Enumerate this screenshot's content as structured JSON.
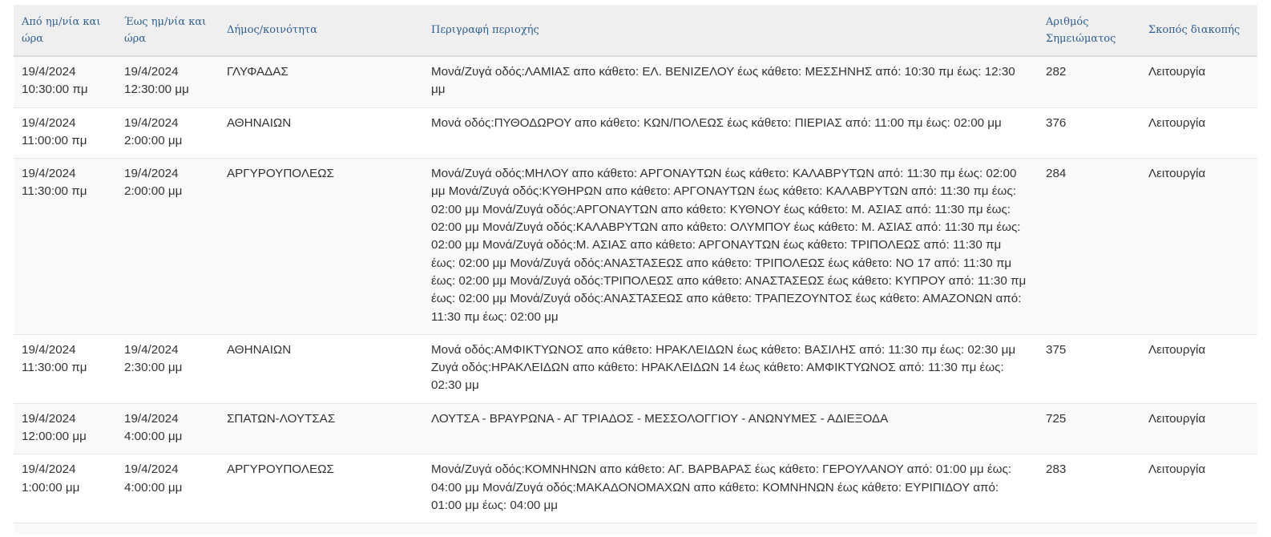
{
  "table": {
    "headers": [
      {
        "key": "from",
        "line1": "Από ημ/νία και",
        "line2": "ώρα"
      },
      {
        "key": "to",
        "line1": "Έως ημ/νία και",
        "line2": "ώρα"
      },
      {
        "key": "municipality",
        "line1": "Δήμος/κοινότητα",
        "line2": ""
      },
      {
        "key": "area",
        "line1": "Περιγραφή περιοχής",
        "line2": ""
      },
      {
        "key": "note_no",
        "line1": "Αριθμός",
        "line2": "Σημειώματος"
      },
      {
        "key": "purpose",
        "line1": "Σκοπός διακοπής",
        "line2": ""
      }
    ],
    "rows": [
      {
        "from_date": "19/4/2024",
        "from_time": "10:30:00 πμ",
        "to_date": "19/4/2024",
        "to_time": "12:30:00 μμ",
        "municipality": "ΓΛΥΦΑΔΑΣ",
        "area": "Μονά/Ζυγά οδός:ΛΑΜΙΑΣ απο κάθετο: ΕΛ. ΒΕΝΙΖΕΛΟΥ έως κάθετο: ΜΕΣΣΗΝΗΣ από: 10:30 πμ έως: 12:30 μμ",
        "note_no": "282",
        "purpose": "Λειτουργία"
      },
      {
        "from_date": "19/4/2024",
        "from_time": "11:00:00 πμ",
        "to_date": "19/4/2024",
        "to_time": "2:00:00 μμ",
        "municipality": "ΑΘΗΝΑΙΩΝ",
        "area": "Μονά οδός:ΠΥΘΟΔΩΡΟΥ απο κάθετο: ΚΩΝ/ΠΟΛΕΩΣ έως κάθετο: ΠΙΕΡΙΑΣ από: 11:00 πμ έως: 02:00 μμ",
        "note_no": "376",
        "purpose": "Λειτουργία"
      },
      {
        "from_date": "19/4/2024",
        "from_time": "11:30:00 πμ",
        "to_date": "19/4/2024",
        "to_time": "2:00:00 μμ",
        "municipality": "ΑΡΓΥΡΟΥΠΟΛΕΩΣ",
        "area": "Μονά/Ζυγά οδός:ΜΗΛΟΥ απο κάθετο: ΑΡΓΟΝΑΥΤΩΝ έως κάθετο: ΚΑΛΑΒΡΥΤΩΝ από: 11:30 πμ έως: 02:00 μμ Μονά/Ζυγά οδός:ΚΥΘΗΡΩΝ απο κάθετο: ΑΡΓΟΝΑΥΤΩΝ έως κάθετο: ΚΑΛΑΒΡΥΤΩΝ από: 11:30 πμ έως: 02:00 μμ Μονά/Ζυγά οδός:ΑΡΓΟΝΑΥΤΩΝ απο κάθετο: ΚΥΘΝΟΥ έως κάθετο: Μ. ΑΣΙΑΣ από: 11:30 πμ έως: 02:00 μμ Μονά/Ζυγά οδός:ΚΑΛΑΒΡΥΤΩΝ απο κάθετο: ΟΛΥΜΠΟΥ έως κάθετο: Μ. ΑΣΙΑΣ από: 11:30 πμ έως: 02:00 μμ Μονά/Ζυγά οδός:Μ. ΑΣΙΑΣ απο κάθετο: ΑΡΓΟΝΑΥΤΩΝ έως κάθετο: ΤΡΙΠΟΛΕΩΣ από: 11:30 πμ έως: 02:00 μμ Μονά/Ζυγά οδός:ΑΝΑΣΤΑΣΕΩΣ απο κάθετο: ΤΡΙΠΟΛΕΩΣ έως κάθετο: ΝΟ 17 από: 11:30 πμ έως: 02:00 μμ Μονά/Ζυγά οδός:ΤΡΙΠΟΛΕΩΣ απο κάθετο: ΑΝΑΣΤΑΣΕΩΣ έως κάθετο: ΚΥΠΡΟΥ από: 11:30 πμ έως: 02:00 μμ Μονά/Ζυγά οδός:ΑΝΑΣΤΑΣΕΩΣ απο κάθετο: ΤΡΑΠΕΖΟΥΝΤΟΣ έως κάθετο: ΑΜΑΖΟΝΩΝ από: 11:30 πμ έως: 02:00 μμ",
        "note_no": "284",
        "purpose": "Λειτουργία"
      },
      {
        "from_date": "19/4/2024",
        "from_time": "11:30:00 πμ",
        "to_date": "19/4/2024",
        "to_time": "2:30:00 μμ",
        "municipality": "ΑΘΗΝΑΙΩΝ",
        "area": "Μονά οδός:ΑΜΦΙΚΤΥΩΝΟΣ απο κάθετο: ΗΡΑΚΛΕΙΔΩΝ έως κάθετο: ΒΑΣΙΛΗΣ από: 11:30 πμ έως: 02:30 μμ Ζυγά οδός:ΗΡΑΚΛΕΙΔΩΝ απο κάθετο: ΗΡΑΚΛΕΙΔΩΝ 14 έως κάθετο: ΑΜΦΙΚΤΥΩΝΟΣ από: 11:30 πμ έως: 02:30 μμ",
        "note_no": "375",
        "purpose": "Λειτουργία"
      },
      {
        "from_date": "19/4/2024",
        "from_time": "12:00:00 μμ",
        "to_date": "19/4/2024",
        "to_time": "4:00:00 μμ",
        "municipality": "ΣΠΑΤΩΝ-ΛΟΥΤΣΑΣ",
        "area": "ΛΟΥΤΣΑ - ΒΡΑΥΡΩΝΑ - ΑΓ ΤΡΙΑΔΟΣ - ΜΕΣΣΟΛΟΓΓΙΟΥ - ΑΝΩΝΥΜΕΣ - ΑΔΙΕΞΟΔΑ",
        "note_no": "725",
        "purpose": "Λειτουργία"
      },
      {
        "from_date": "19/4/2024",
        "from_time": "1:00:00 μμ",
        "to_date": "19/4/2024",
        "to_time": "4:00:00 μμ",
        "municipality": "ΑΡΓΥΡΟΥΠΟΛΕΩΣ",
        "area": "Μονά/Ζυγά οδός:ΚΟΜΝΗΝΩΝ απο κάθετο: ΑΓ. ΒΑΡΒΑΡΑΣ έως κάθετο: ΓΕΡΟΥΛΑΝΟΥ από: 01:00 μμ έως: 04:00 μμ Μονά/Ζυγά οδός:ΜΑΚΑΔΟΝΟΜΑΧΩΝ απο κάθετο: ΚΟΜΝΗΝΩΝ έως κάθετο: ΕΥΡΙΠΙΔΟΥ από: 01:00 μμ έως: 04:00 μμ",
        "note_no": "283",
        "purpose": "Λειτουργία"
      }
    ]
  }
}
